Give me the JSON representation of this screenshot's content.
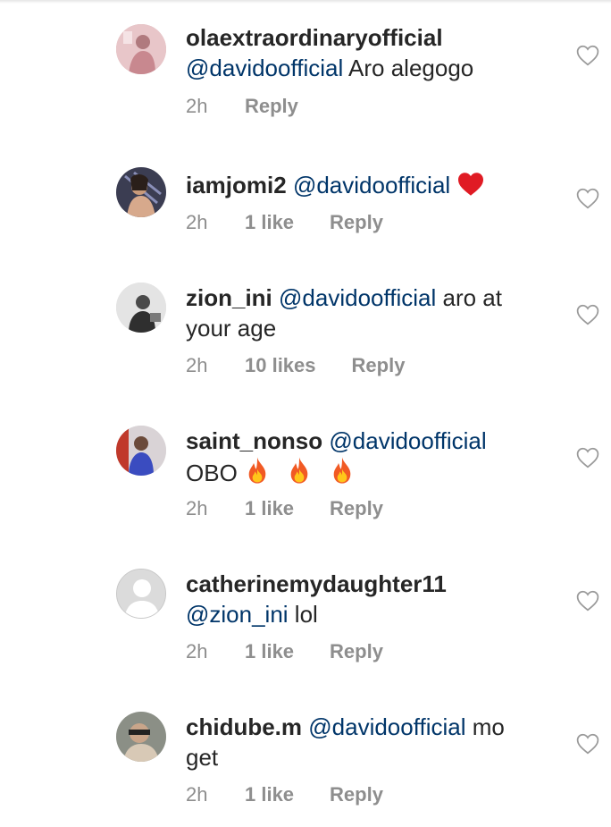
{
  "comments": [
    {
      "username": "olaextraordinaryofficial",
      "mention": "@davidoofficial",
      "text": " Aro alegogo",
      "time": "2h",
      "likes": "",
      "reply": "Reply",
      "emoji": ""
    },
    {
      "username": "iamjomi2",
      "mention": "@davidoofficial",
      "text": "",
      "time": "2h",
      "likes": "1 like",
      "reply": "Reply",
      "emoji": "heart"
    },
    {
      "username": "zion_ini",
      "mention": "@davidoofficial",
      "text": " aro at your age",
      "time": "2h",
      "likes": "10 likes",
      "reply": "Reply",
      "emoji": ""
    },
    {
      "username": "saint_nonso",
      "mention": "@davidoofficial",
      "text": "OBO",
      "time": "2h",
      "likes": "1 like",
      "reply": "Reply",
      "emoji": "fire-x3"
    },
    {
      "username": "catherinemydaughter11",
      "mention": "@zion_ini",
      "text": " lol",
      "time": "2h",
      "likes": "1 like",
      "reply": "Reply",
      "emoji": ""
    },
    {
      "username": "chidube.m",
      "mention": "@davidoofficial",
      "text": " mo get",
      "time": "2h",
      "likes": "1 like",
      "reply": "Reply",
      "emoji": ""
    }
  ],
  "colors": {
    "mention": "#003569",
    "meta": "#8e8e8e",
    "text": "#262626"
  }
}
